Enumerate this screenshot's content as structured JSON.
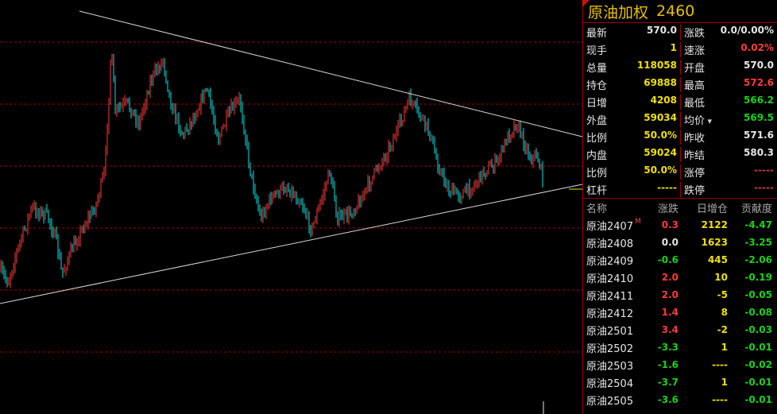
{
  "title": {
    "name": "原油加权",
    "code": "2460"
  },
  "colors": {
    "up": "#ff3a3a",
    "down": "#00e5e5",
    "grid": "#a00000",
    "trend": "#d8d8d8",
    "value_yellow": "#f0e000",
    "value_green": "#19d219"
  },
  "quote_rows": [
    {
      "left": {
        "label": "最新",
        "value": "570.0",
        "color": "w"
      },
      "right": {
        "label": "涨跌",
        "value": "0.0/0.00%",
        "color": "w"
      }
    },
    {
      "left": {
        "label": "现手",
        "value": "1",
        "color": "y"
      },
      "right": {
        "label": "速涨",
        "value": "0.02%",
        "color": "r"
      }
    },
    {
      "left": {
        "label": "总量",
        "value": "118058",
        "color": "y"
      },
      "right": {
        "label": "开盘",
        "value": "570.0",
        "color": "w"
      }
    },
    {
      "left": {
        "label": "持仓",
        "value": "69888",
        "color": "y"
      },
      "right": {
        "label": "最高",
        "value": "572.6",
        "color": "r"
      }
    },
    {
      "left": {
        "label": "日增",
        "value": "4208",
        "color": "y"
      },
      "right": {
        "label": "最低",
        "value": "566.2",
        "color": "g"
      }
    },
    {
      "left": {
        "label": "外盘",
        "value": "59034",
        "color": "y"
      },
      "right": {
        "label": "均价",
        "value": "569.5",
        "color": "g",
        "icon": "triangle-down-icon"
      }
    },
    {
      "left": {
        "label": "比例",
        "value": "50.0%",
        "color": "y"
      },
      "right": {
        "label": "昨收",
        "value": "571.6",
        "color": "w"
      }
    },
    {
      "left": {
        "label": "内盘",
        "value": "59024",
        "color": "y"
      },
      "right": {
        "label": "昨结",
        "value": "580.3",
        "color": "w"
      }
    },
    {
      "left": {
        "label": "比例",
        "value": "50.0%",
        "color": "y"
      },
      "right": {
        "label": "涨停",
        "value": "-----",
        "color": "d"
      }
    },
    {
      "left": {
        "label": "杠杆",
        "value": "-----",
        "color": "y"
      },
      "right": {
        "label": "跌停",
        "value": "-----",
        "color": "d"
      }
    }
  ],
  "list_header": {
    "name": "名称",
    "change": "涨跌",
    "daily_oi": "日增仓",
    "contribution": "贡献度"
  },
  "contracts": [
    {
      "name": "原油2407",
      "mark": "M",
      "change": "0.3",
      "change_color": "r",
      "oi": "2122",
      "contrib": "-4.47"
    },
    {
      "name": "原油2408",
      "mark": "",
      "change": "0.0",
      "change_color": "w",
      "oi": "1623",
      "contrib": "-3.25"
    },
    {
      "name": "原油2409",
      "mark": "",
      "change": "-0.6",
      "change_color": "g",
      "oi": "445",
      "contrib": "-2.06"
    },
    {
      "name": "原油2410",
      "mark": "",
      "change": "2.0",
      "change_color": "r",
      "oi": "10",
      "contrib": "-0.19"
    },
    {
      "name": "原油2411",
      "mark": "",
      "change": "2.0",
      "change_color": "r",
      "oi": "-5",
      "contrib": "-0.05"
    },
    {
      "name": "原油2412",
      "mark": "",
      "change": "1.4",
      "change_color": "r",
      "oi": "8",
      "contrib": "-0.08"
    },
    {
      "name": "原油2501",
      "mark": "",
      "change": "3.4",
      "change_color": "r",
      "oi": "-2",
      "contrib": "-0.03"
    },
    {
      "name": "原油2502",
      "mark": "",
      "change": "-3.3",
      "change_color": "g",
      "oi": "1",
      "contrib": "-0.01"
    },
    {
      "name": "原油2503",
      "mark": "",
      "change": "-1.6",
      "change_color": "g",
      "oi": "----",
      "contrib": "-0.02"
    },
    {
      "name": "原油2504",
      "mark": "",
      "change": "-3.7",
      "change_color": "g",
      "oi": "1",
      "contrib": "-0.01"
    },
    {
      "name": "原油2505",
      "mark": "",
      "change": "-3.6",
      "change_color": "g",
      "oi": "----",
      "contrib": "-0.01"
    }
  ]
}
